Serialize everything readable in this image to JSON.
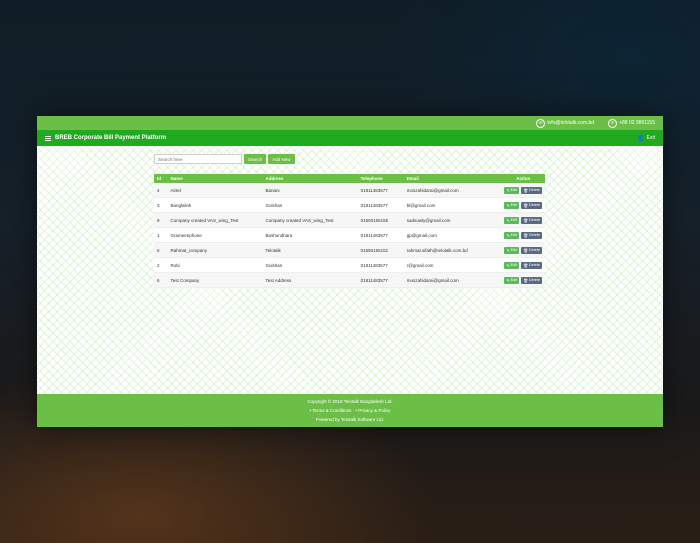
{
  "topbar": {
    "email": "info@telotalk.com.bd",
    "phone": "+88 02 9861155"
  },
  "navbar": {
    "title": "BREB Corporate Bill Payment Platform",
    "exit_label": "Exit"
  },
  "toolbar": {
    "search_placeholder": "Search here",
    "search_label": "Search",
    "add_label": "Add New"
  },
  "table": {
    "headers": [
      "Id",
      "Name",
      "Address",
      "Telephone",
      "Email",
      "Action"
    ],
    "edit_label": "Edit",
    "delete_label": "Delete",
    "rows": [
      [
        "4",
        "Airtel",
        "Banani",
        "01811483577",
        "moszahidarai@gmail.com"
      ],
      [
        "3",
        "Banglalink",
        "Gulshan",
        "01811483577",
        "bl@gmail.com"
      ],
      [
        "9",
        "Company created VAS_wing_Test",
        "Company created VAS_wing_Test",
        "01550155155",
        "sadsowly@gmail.com"
      ],
      [
        "1",
        "Grameenphone",
        "Bashundhara",
        "01811483577",
        "gp@gmail.com"
      ],
      [
        "5",
        "Rahmat_company",
        "Telotalk",
        "01550155151",
        "rahmat.sifath@telotalk.com.bd"
      ],
      [
        "2",
        "Robi",
        "Gulshan",
        "01811483577",
        "r@gmail.com"
      ],
      [
        "6",
        "Test Company",
        "Test Address",
        "01811483577",
        "moszahidarai@gmail.com"
      ]
    ]
  },
  "footer": {
    "copyright": "Copyright © 2019 Telotalk Bangladesh Ltd.",
    "terms": "• Terms & Conditions",
    "privacy": "• Privacy & Policy",
    "powered": "Powered by Telotalk Software Ltd."
  }
}
